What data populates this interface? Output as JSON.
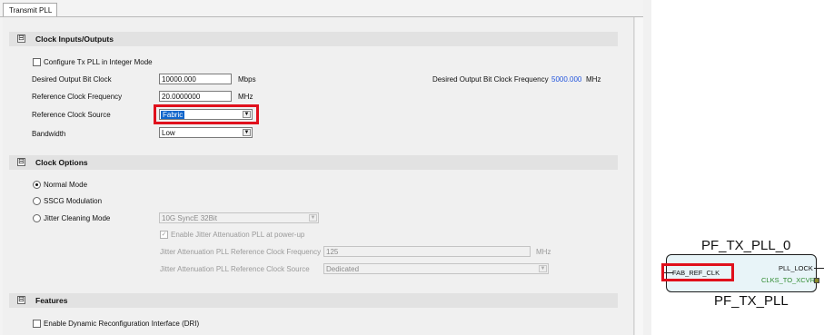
{
  "tab": {
    "label": "Transmit PLL"
  },
  "sections": {
    "clock_io": {
      "title": "Clock Inputs/Outputs"
    },
    "clock_options": {
      "title": "Clock Options"
    },
    "features": {
      "title": "Features"
    }
  },
  "collapse_glyph": "⊟",
  "clock_io": {
    "integer_mode_label": "Configure Tx PLL in Integer Mode",
    "desired_output_label": "Desired Output Bit Clock",
    "desired_output_value": "10000.000",
    "desired_output_unit": "Mbps",
    "desired_freq_label": "Desired Output Bit Clock Frequency",
    "desired_freq_value": "5000.000",
    "desired_freq_unit": "MHz",
    "ref_freq_label": "Reference Clock Frequency",
    "ref_freq_value": "20.0000000",
    "ref_freq_unit": "MHz",
    "ref_source_label": "Reference Clock Source",
    "ref_source_value": "Fabric",
    "bandwidth_label": "Bandwidth",
    "bandwidth_value": "Low"
  },
  "clock_options": {
    "normal_mode": "Normal Mode",
    "sscg": "SSCG Modulation",
    "jitter_cleaning": "Jitter Cleaning Mode",
    "jitter_mode_value": "10G SyncE 32Bit",
    "enable_jitter_label": "Enable Jitter Attenuation PLL at power-up",
    "jitter_ref_freq_label": "Jitter Attenuation PLL Reference Clock Frequency",
    "jitter_ref_freq_value": "125",
    "jitter_ref_freq_unit": "MHz",
    "jitter_ref_source_label": "Jitter Attenuation PLL Reference Clock Source",
    "jitter_ref_source_value": "Dedicated"
  },
  "features": {
    "dri_label": "Enable Dynamic Reconfiguration Interface (DRI)"
  },
  "block": {
    "instance_name": "PF_TX_PLL_0",
    "component_name": "PF_TX_PLL",
    "port_in": "FAB_REF_CLK",
    "port_lock": "PLL_LOCK",
    "port_clks": "CLKS_TO_XCVR"
  },
  "glyphs": {
    "check": "✓",
    "arrow": "▼"
  },
  "colors": {
    "highlight": "#e0101c",
    "link_value": "#2255dd",
    "block_fill": "#e8f4f8"
  }
}
